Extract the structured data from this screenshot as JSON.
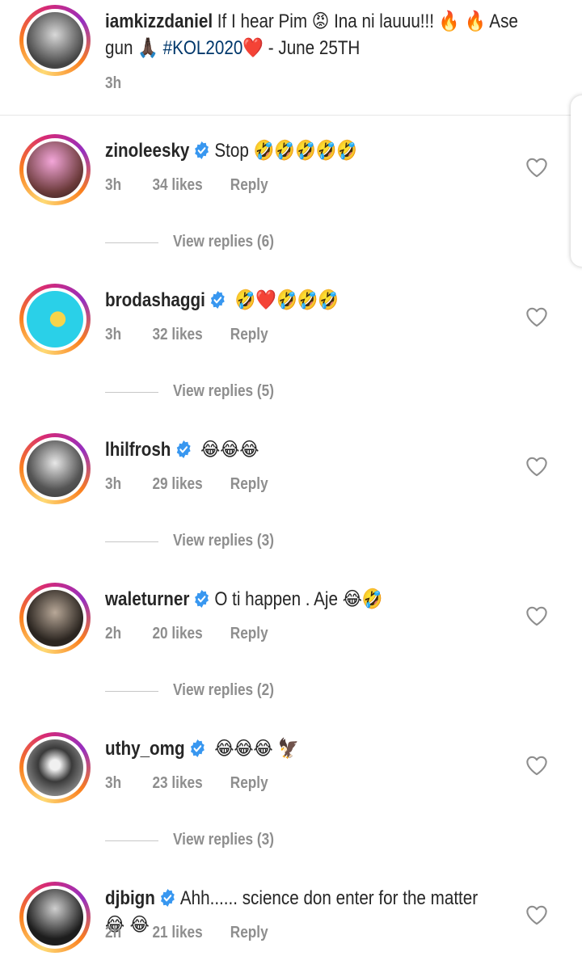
{
  "caption": {
    "username": "iamkizzdaniel",
    "text_a": "If I hear Pim",
    "emoji_a": "😡",
    "text_b": "Ina ni lauuu!!!",
    "emoji_b": "🔥 🔥",
    "text_c": "Ase gun",
    "emoji_c": "🙏🏿",
    "hashtag": "#KOL2020",
    "emoji_d": "❤️",
    "text_d": "- June 25TH",
    "time": "3h"
  },
  "comments": [
    {
      "username": "zinoleesky",
      "verified": true,
      "text": "Stop",
      "emoji": "🤣🤣🤣🤣🤣",
      "time": "3h",
      "likes": "34 likes",
      "reply": "Reply",
      "view_replies": "View replies (6)"
    },
    {
      "username": "brodashaggi",
      "verified": true,
      "text": "",
      "emoji": "🤣❤️🤣🤣🤣",
      "time": "3h",
      "likes": "32 likes",
      "reply": "Reply",
      "view_replies": "View replies (5)"
    },
    {
      "username": "lhilfrosh",
      "verified": true,
      "text": "",
      "emoji": "😂😂😂",
      "time": "3h",
      "likes": "29 likes",
      "reply": "Reply",
      "view_replies": "View replies (3)"
    },
    {
      "username": "waleturner",
      "verified": true,
      "text": "O ti happen . Aje",
      "emoji": "😂🤣",
      "time": "2h",
      "likes": "20 likes",
      "reply": "Reply",
      "view_replies": "View replies (2)"
    },
    {
      "username": "uthy_omg",
      "verified": true,
      "text": "",
      "emoji": "😂😂😂 🦅",
      "time": "3h",
      "likes": "23 likes",
      "reply": "Reply",
      "view_replies": "View replies (3)"
    },
    {
      "username": "djbign",
      "verified": true,
      "text": "Ahh...... science don enter for the matter",
      "emoji": "😂",
      "emoji2": "😂",
      "time": "2h",
      "likes": "21 likes",
      "reply": "Reply"
    }
  ],
  "colors": {
    "verified": "#3897f0",
    "hashtag": "#00376b",
    "meta": "#8e8e8e"
  }
}
